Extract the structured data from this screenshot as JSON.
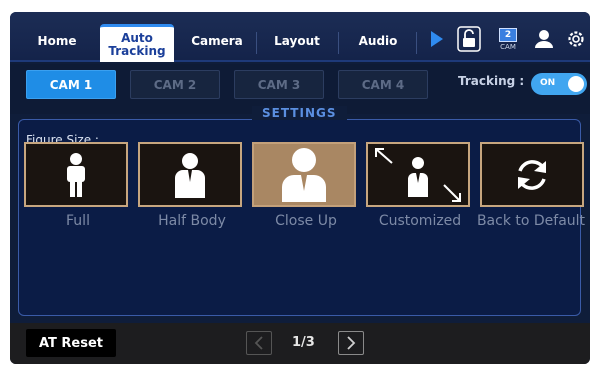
{
  "nav": {
    "tabs": [
      {
        "label": "Home",
        "active": false
      },
      {
        "label": "Auto Tracking",
        "line1": "Auto",
        "line2": "Tracking",
        "active": true
      },
      {
        "label": "Camera",
        "active": false
      },
      {
        "label": "Layout",
        "active": false
      },
      {
        "label": "Audio",
        "active": false
      }
    ],
    "icons": [
      "play-icon",
      "unlock-icon",
      "cam-badge-icon",
      "user-icon",
      "gear-icon"
    ],
    "cam_badge_number": "2",
    "cam_badge_text": "CAM"
  },
  "cams": {
    "buttons": [
      "CAM 1",
      "CAM 2",
      "CAM 3",
      "CAM 4"
    ],
    "active": "CAM 1"
  },
  "tracking": {
    "label": "Tracking :",
    "state": "ON"
  },
  "settings": {
    "title": "SETTINGS",
    "figure_size_label": "Figure Size :",
    "options": [
      {
        "label": "Full",
        "icon": "full-body-icon",
        "active": false
      },
      {
        "label": "Half Body",
        "icon": "half-body-icon",
        "active": false
      },
      {
        "label": "Close Up",
        "icon": "close-up-icon",
        "active": true
      },
      {
        "label": "Customized",
        "icon": "customized-resize-icon",
        "active": false
      },
      {
        "label": "Back to Default",
        "icon": "refresh-icon",
        "active": false
      }
    ]
  },
  "bottom": {
    "reset_label": "AT Reset",
    "page": "1/3"
  },
  "colors": {
    "accent": "#1f8de6",
    "selected_tile": "#a98763",
    "background": "#0f1d3a"
  }
}
